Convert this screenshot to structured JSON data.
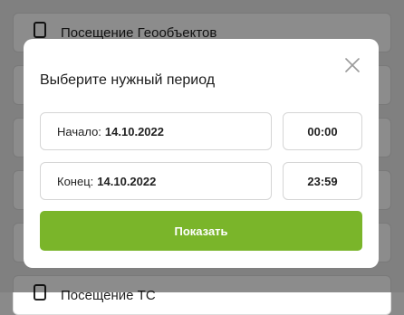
{
  "background": {
    "top_item_label": "Посещение Геообъектов",
    "bottom_item_label": "Посещение ТС"
  },
  "modal": {
    "title": "Выберите нужный период",
    "start": {
      "label": "Начало:",
      "date": "14.10.2022",
      "time": "00:00"
    },
    "end": {
      "label": "Конец:",
      "date": "14.10.2022",
      "time": "23:59"
    },
    "submit_label": "Показать"
  },
  "colors": {
    "accent": "#7ab52a",
    "overlay": "rgba(0,0,0,0.45)"
  },
  "icons": {
    "close": "close-icon",
    "list_item": "clipboard-icon"
  }
}
